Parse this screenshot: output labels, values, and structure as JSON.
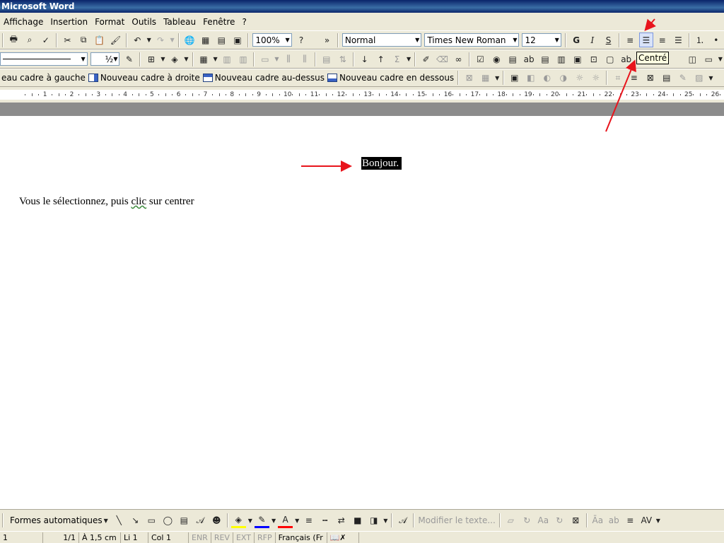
{
  "window": {
    "title": "Microsoft Word"
  },
  "menu": [
    "Affichage",
    "Insertion",
    "Format",
    "Outils",
    "Tableau",
    "Fenêtre",
    "?"
  ],
  "standard_toolbar": {
    "zoom": "100%",
    "more": "»"
  },
  "formatting_toolbar": {
    "style": "Normal",
    "font": "Times New Roman",
    "size": "12",
    "bold": "G",
    "italic": "I",
    "underline": "S"
  },
  "tables_toolbar": {
    "line_weight": "½",
    "sum": "Σ"
  },
  "frames_toolbar": {
    "left": "eau cadre à gauche",
    "right": "Nouveau cadre à droite",
    "above": "Nouveau cadre au-dessus",
    "below": "Nouveau cadre en dessous"
  },
  "tooltip": "Centré",
  "ruler": [
    "1",
    "2",
    "3",
    "4",
    "5",
    "6",
    "7",
    "8",
    "9",
    "10",
    "11",
    "12",
    "13",
    "14",
    "15",
    "16",
    "17",
    "18",
    "19",
    "20",
    "21",
    "22",
    "23",
    "24",
    "25",
    "26"
  ],
  "document": {
    "line1": "Bonjour.",
    "line2_pre": "Vous le sélectionnez, puis ",
    "line2_word": "clic",
    "line2_post": " sur centrer"
  },
  "drawing_toolbar": {
    "autoshapes": "Formes automatiques",
    "edit_text": "Modifier le texte..."
  },
  "status": {
    "page": "1",
    "pages": "1/1",
    "at": "À 1,5 cm",
    "line": "Li 1",
    "col": "Col 1",
    "rec": "ENR",
    "trk": "REV",
    "ext": "EXT",
    "ovr": "RFP",
    "lang": "Français (Fr"
  },
  "colors": {
    "annotation_red": "#e8141c",
    "selection": "#000000"
  }
}
